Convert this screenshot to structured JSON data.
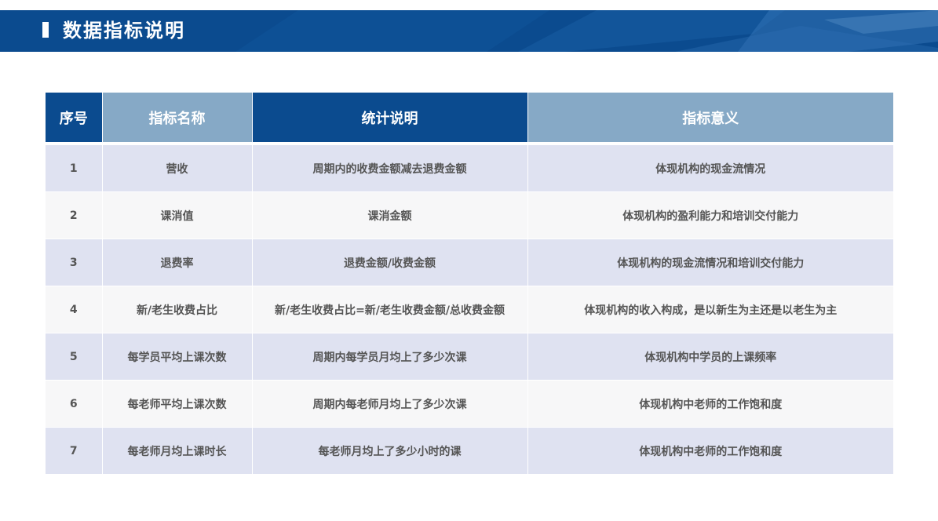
{
  "page": {
    "title": "数据指标说明"
  },
  "table": {
    "headers": [
      "序号",
      "指标名称",
      "统计说明",
      "指标意义"
    ],
    "rows": [
      {
        "index": "1",
        "name": "营收",
        "stat": "周期内的收费金额减去退费金额",
        "meaning": "体现机构的现金流情况"
      },
      {
        "index": "2",
        "name": "课消值",
        "stat": "课消金额",
        "meaning": "体现机构的盈利能力和培训交付能力"
      },
      {
        "index": "3",
        "name": "退费率",
        "stat": "退费金额/收费金额",
        "meaning": "体现机构的现金流情况和培训交付能力"
      },
      {
        "index": "4",
        "name": "新/老生收费占比",
        "stat": "新/老生收费占比=新/老生收费金额/总收费金额",
        "meaning": "体现机构的收入构成，是以新生为主还是以老生为主"
      },
      {
        "index": "5",
        "name": "每学员平均上课次数",
        "stat": "周期内每学员月均上了多少次课",
        "meaning": "体现机构中学员的上课频率"
      },
      {
        "index": "6",
        "name": "每老师平均上课次数",
        "stat": "周期内每老师月均上了多少次课",
        "meaning": "体现机构中老师的工作饱和度"
      },
      {
        "index": "7",
        "name": "每老师月均上课时长",
        "stat": "每老师月均上了多少小时的课",
        "meaning": "体现机构中老师的工作饱和度"
      }
    ]
  },
  "colors": {
    "brand_dark": "#0b4b8f",
    "brand_light": "#86a9c6",
    "row_odd": "#dfe2f1",
    "row_even": "#f7f7f8",
    "text": "#555555"
  }
}
